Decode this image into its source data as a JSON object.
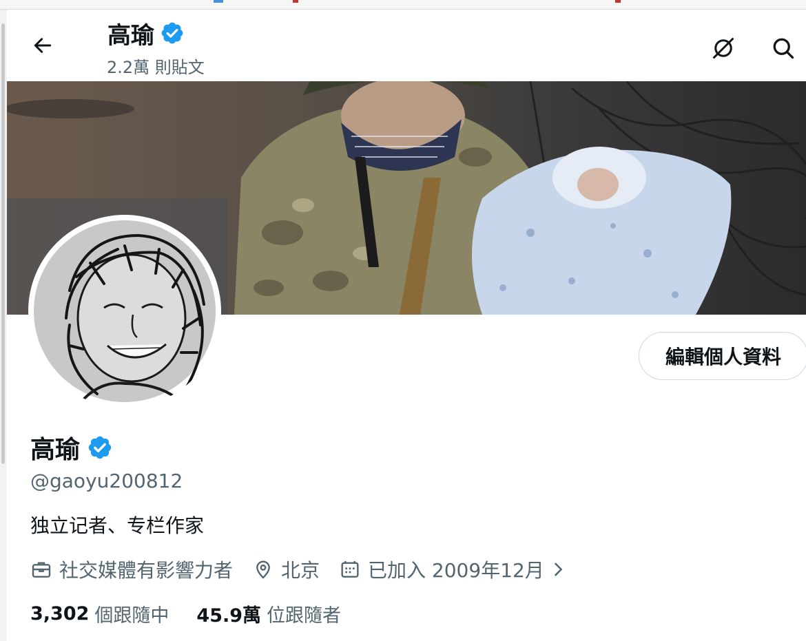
{
  "header": {
    "display_name": "高瑜",
    "post_count": "2.2萬 則貼文"
  },
  "profile": {
    "display_name": "高瑜",
    "handle": "@gaoyu200812",
    "bio": "独立记者、专栏作家",
    "category": "社交媒體有影響力者",
    "location": "北京",
    "joined": "已加入 2009年12月",
    "edit_button": "編輯個人資料"
  },
  "stats": {
    "following_count": "3,302",
    "following_label": "個跟隨中",
    "followers_count": "45.9萬",
    "followers_label": "位跟隨者"
  },
  "colors": {
    "verified": "#1d9bf0",
    "secondary_text": "#536471",
    "primary_text": "#0f1419",
    "button_border": "#cfd9de"
  },
  "icons": {
    "back": "arrow-left-icon",
    "verified": "verified-badge-icon",
    "grok": "grok-icon",
    "search": "search-icon",
    "category": "briefcase-icon",
    "location": "location-pin-icon",
    "joined": "calendar-icon",
    "expand": "chevron-right-icon"
  }
}
